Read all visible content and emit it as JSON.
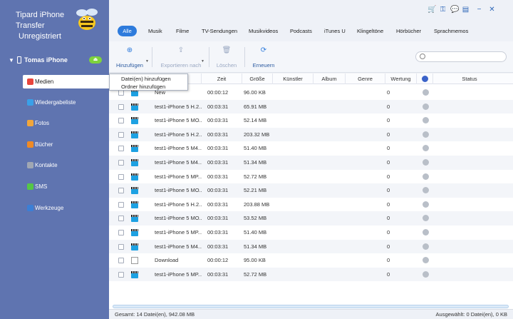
{
  "app": {
    "title_line1": "Tipard iPhone",
    "title_line2": "Transfer",
    "title_line3": "Unregistriert"
  },
  "device": {
    "name": "Tomas iPhone",
    "eject_label": "⏏"
  },
  "sidebar": {
    "items": [
      {
        "label": "Medien",
        "icon": "music-icon",
        "color": "#e8453c"
      },
      {
        "label": "Wiedergabeliste",
        "icon": "playlist-icon",
        "color": "#3aa0e8"
      },
      {
        "label": "Fotos",
        "icon": "photos-icon",
        "color": "#f2a63a"
      },
      {
        "label": "Bücher",
        "icon": "books-icon",
        "color": "#f08a24"
      },
      {
        "label": "Kontakte",
        "icon": "contacts-icon",
        "color": "#a0a7b3"
      },
      {
        "label": "SMS",
        "icon": "sms-icon",
        "color": "#55c746"
      },
      {
        "label": "Werkzeuge",
        "icon": "toolbox-icon",
        "color": "#3b7fd6"
      }
    ]
  },
  "window_controls": {
    "cart": "🛒",
    "key": "⚿",
    "chat": "💬",
    "feedback": "▤",
    "minimize": "−",
    "close": "✕"
  },
  "tabs": [
    {
      "label": "Alle"
    },
    {
      "label": "Musik"
    },
    {
      "label": "Filme"
    },
    {
      "label": "TV-Sendungen"
    },
    {
      "label": "Musikvideos"
    },
    {
      "label": "Podcasts"
    },
    {
      "label": "iTunes U"
    },
    {
      "label": "Klingeltöne"
    },
    {
      "label": "Hörbücher"
    },
    {
      "label": "Sprachmemos"
    }
  ],
  "toolbar": {
    "add_label": "Hinzufügen",
    "export_label": "Exportieren nach",
    "delete_label": "Löschen",
    "refresh_label": "Erneuern",
    "search_placeholder": ""
  },
  "dropdown": {
    "item1": "Datei(en) hinzufügen",
    "item2": "Ordner hinzufügen"
  },
  "columns": {
    "time": "Zeit",
    "size": "Größe",
    "artist": "Künstler",
    "album": "Album",
    "genre": "Genre",
    "rating": "Wertung",
    "status": "Status"
  },
  "rows": [
    {
      "name": "New",
      "time": "00:00:12",
      "size": "96.00 KB",
      "rating": "0",
      "type": "video"
    },
    {
      "name": "test1-iPhone 5 H.2...",
      "time": "00:03:31",
      "size": "65.91 MB",
      "rating": "0",
      "type": "video"
    },
    {
      "name": "test1-iPhone 5 MO...",
      "time": "00:03:31",
      "size": "52.14 MB",
      "rating": "0",
      "type": "video"
    },
    {
      "name": "test1-iPhone 5 H.2...",
      "time": "00:03:31",
      "size": "203.32 MB",
      "rating": "0",
      "type": "video"
    },
    {
      "name": "test1-iPhone 5 M4...",
      "time": "00:03:31",
      "size": "51.40 MB",
      "rating": "0",
      "type": "video"
    },
    {
      "name": "test1-iPhone 5 M4...",
      "time": "00:03:31",
      "size": "51.34 MB",
      "rating": "0",
      "type": "video"
    },
    {
      "name": "test1-iPhone 5 MP...",
      "time": "00:03:31",
      "size": "52.72 MB",
      "rating": "0",
      "type": "video"
    },
    {
      "name": "test1-iPhone 5 MO...",
      "time": "00:03:31",
      "size": "52.21 MB",
      "rating": "0",
      "type": "video"
    },
    {
      "name": "test1-iPhone 5 H.2...",
      "time": "00:03:31",
      "size": "203.88 MB",
      "rating": "0",
      "type": "video"
    },
    {
      "name": "test1-iPhone 5 MO...",
      "time": "00:03:31",
      "size": "53.52 MB",
      "rating": "0",
      "type": "video"
    },
    {
      "name": "test1-iPhone 5 MP...",
      "time": "00:03:31",
      "size": "51.40 MB",
      "rating": "0",
      "type": "video"
    },
    {
      "name": "test1-iPhone 5 M4...",
      "time": "00:03:31",
      "size": "51.34 MB",
      "rating": "0",
      "type": "video"
    },
    {
      "name": "Download",
      "time": "00:00:12",
      "size": "95.00 KB",
      "rating": "0",
      "type": "document"
    },
    {
      "name": "test1-iPhone 5 MP...",
      "time": "00:03:31",
      "size": "52.72 MB",
      "rating": "0",
      "type": "video"
    }
  ],
  "status": {
    "total": "Gesamt: 14 Datei(en), 942.08 MB",
    "selected": "Ausgewählt: 0 Datei(en), 0 KB"
  },
  "colors": {
    "sidebar": "#5f74b0",
    "accent": "#2e7bdc"
  }
}
